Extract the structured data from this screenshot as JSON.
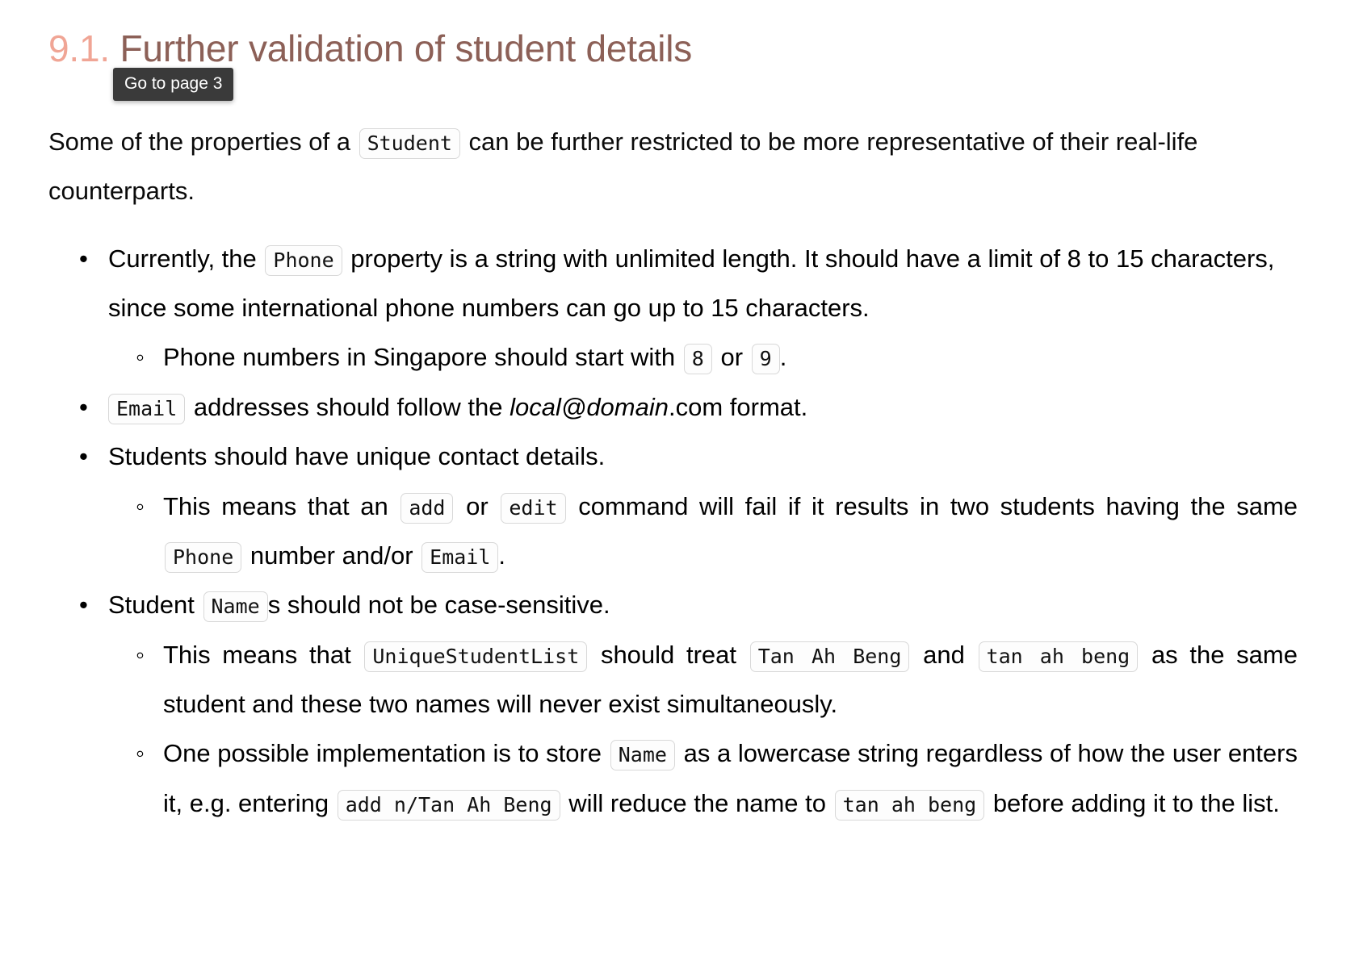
{
  "heading": {
    "number": "9.1.",
    "title": "Further validation of student details"
  },
  "tooltip": {
    "label": "Go to page 3"
  },
  "intro": {
    "part1": "Some of the properties of a",
    "code_student": "Student",
    "part2": "can be further restricted to be more representative of their real-life counterparts."
  },
  "bullets": {
    "phone": {
      "part1": "Currently, the",
      "code_phone": "Phone",
      "part2": "property is a string with unlimited length. It should have a limit of 8 to 15 characters, since some international phone numbers can go up to 15 characters.",
      "sub": {
        "part1": "Phone numbers in Singapore should start with",
        "code_8": "8",
        "part2": "or",
        "code_9": "9",
        "part3": "."
      }
    },
    "email": {
      "code_email": "Email",
      "part1": "addresses should follow the",
      "emphasis": "local@domain",
      "part2": ".com format."
    },
    "unique_contact": {
      "text": "Students should have unique contact details.",
      "sub": {
        "part1": "This means that an",
        "code_add": "add",
        "part2": "or",
        "code_edit": "edit",
        "part3": "command will fail if it results in two students having the same",
        "code_phone": "Phone",
        "part4": "number and/or",
        "code_email": "Email",
        "part5": "."
      }
    },
    "name_case": {
      "part1": "Student",
      "code_name": "Name",
      "part2": "s should not be case-sensitive.",
      "sub1": {
        "part1": "This means that",
        "code_list": "UniqueStudentList",
        "part2": "should treat",
        "code_tan_upper": "Tan Ah Beng",
        "part3": "and",
        "code_tan_lower": "tan ah beng",
        "part4": "as the same student and these two names will never exist simultaneously."
      },
      "sub2": {
        "part1": "One possible implementation is to store",
        "code_name": "Name",
        "part2": "as a lowercase string regardless of how the user enters it, e.g. entering",
        "code_add_cmd": "add n/Tan Ah Beng",
        "part3": "will reduce the name to",
        "code_tan_lower": "tan ah beng",
        "part4": "before adding it to the list."
      }
    }
  },
  "colors": {
    "heading_text": "#8c6057",
    "heading_number": "#f0a595",
    "tooltip_bg": "#3a3a3a",
    "chip_border": "#d8d8d8"
  }
}
